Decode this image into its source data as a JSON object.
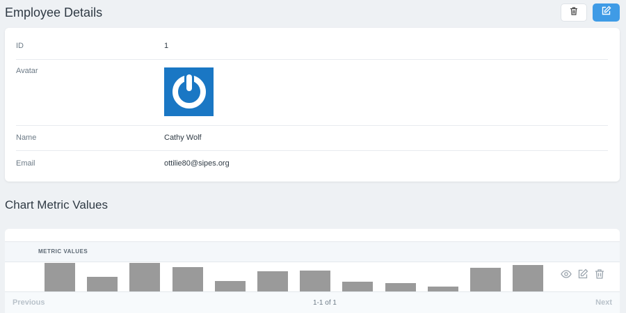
{
  "header": {
    "title": "Employee Details",
    "delete_icon": "trash-icon",
    "edit_icon": "edit-icon"
  },
  "details": {
    "id_label": "ID",
    "id_value": "1",
    "avatar_label": "Avatar",
    "avatar_icon": "power-logo-icon",
    "name_label": "Name",
    "name_value": "Cathy Wolf",
    "email_label": "Email",
    "email_value": "ottilie80@sipes.org"
  },
  "metrics": {
    "title": "Chart Metric Values",
    "column_header": "METRIC VALUES",
    "row_actions": [
      "eye-icon",
      "edit-icon",
      "trash-icon"
    ],
    "pagination": {
      "previous": "Previous",
      "info": "1-1 of 1",
      "next": "Next"
    }
  },
  "chart_data": {
    "type": "bar",
    "values": [
      41,
      21,
      41,
      35,
      15,
      29,
      30,
      14,
      12,
      7,
      34,
      38
    ],
    "bar_color": "#9a9a9a"
  },
  "colors": {
    "accent": "#3f9be6",
    "avatar_bg": "#1a77c4"
  }
}
